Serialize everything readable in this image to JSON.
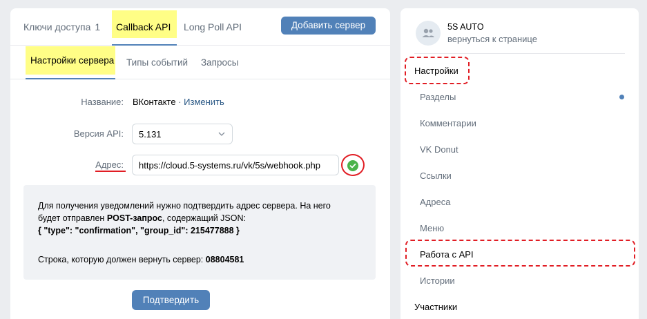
{
  "tabs_top": {
    "access_keys": "Ключи доступа",
    "access_keys_count": "1",
    "callback_api": "Callback API",
    "long_poll_api": "Long Poll API",
    "add_server_button": "Добавить сервер"
  },
  "tabs_sub": {
    "server_settings": "Настройки сервера",
    "event_types": "Типы событий",
    "requests": "Запросы"
  },
  "form": {
    "name_label": "Название:",
    "name_value": "ВКонтакте",
    "name_separator": "·",
    "change_link": "Изменить",
    "api_version_label": "Версия API:",
    "api_version_value": "5.131",
    "address_label": "Адрес:",
    "address_value": "https://cloud.5-systems.ru/vk/5s/webhook.php"
  },
  "info": {
    "line1": "Для получения уведомлений нужно подтвердить адрес сервера. На него",
    "line2_prefix": "будет отправлен ",
    "line2_bold": "POST-запрос",
    "line2_suffix": ", содержащий JSON:",
    "line3_json": "{ \"type\": \"confirmation\", \"group_id\": 215477888 }",
    "line4_prefix": "Строка, которую должен вернуть сервер: ",
    "line4_code": "08804581"
  },
  "confirm_button": "Подтвердить",
  "sidebar": {
    "group_name": "5S AUTO",
    "back_link": "вернуться к странице",
    "settings_section": "Настройки",
    "items": [
      "Разделы",
      "Комментарии",
      "VK Donut",
      "Ссылки",
      "Адреса",
      "Меню",
      "Работа с API",
      "Истории"
    ],
    "members_section": "Участники"
  },
  "colors": {
    "accent": "#5181b8",
    "highlight": "#fffe86",
    "annotation_red": "#e11d24",
    "success_green": "#4bb34b"
  }
}
